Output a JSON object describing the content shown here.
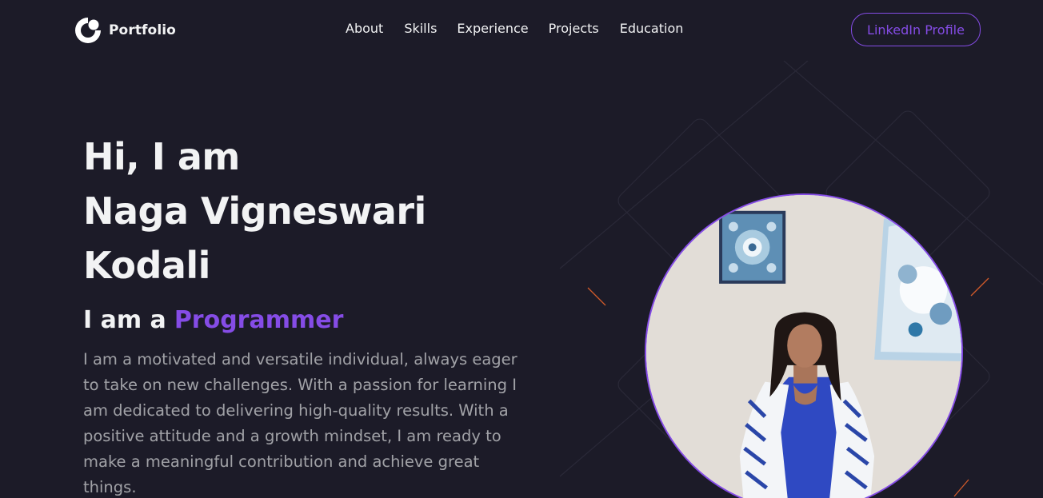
{
  "navbar": {
    "logo_text": "Portfolio",
    "links": [
      "About",
      "Skills",
      "Experience",
      "Projects",
      "Education"
    ],
    "linkedin_button": "LinkedIn Profile"
  },
  "hero": {
    "greeting": "Hi, I am",
    "name_line1": "Naga Vigneswari",
    "name_line2": "Kodali",
    "role_prefix": "I am a",
    "role": "Programmer",
    "description": "I am a motivated and versatile individual, always eager to take on new challenges. With a passion for learning I am dedicated to delivering high-quality results. With a positive attitude and a growth mindset, I am ready to make a meaningful contribution and achieve great things."
  },
  "colors": {
    "background": "#1c1b28",
    "accent": "#854ce6",
    "text_primary": "#f2f3f4"
  },
  "icons": {
    "logo": "portfolio-logo-icon"
  }
}
